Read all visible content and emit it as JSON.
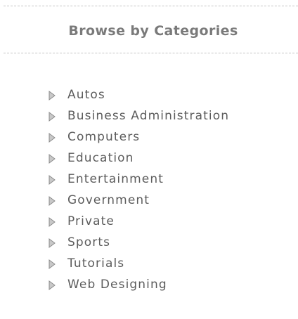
{
  "panel": {
    "title": "Browse by Categories"
  },
  "categories": [
    {
      "label": "Autos",
      "icon": "arrow-right-icon"
    },
    {
      "label": "Business Administration",
      "icon": "arrow-right-icon"
    },
    {
      "label": "Computers",
      "icon": "arrow-right-icon"
    },
    {
      "label": "Education",
      "icon": "arrow-right-icon"
    },
    {
      "label": "Entertainment",
      "icon": "arrow-right-icon"
    },
    {
      "label": "Government",
      "icon": "arrow-right-icon"
    },
    {
      "label": "Private",
      "icon": "arrow-right-icon"
    },
    {
      "label": "Sports",
      "icon": "arrow-right-icon"
    },
    {
      "label": "Tutorials",
      "icon": "arrow-right-icon"
    },
    {
      "label": "Web Designing",
      "icon": "arrow-right-icon"
    }
  ],
  "colors": {
    "heading": "#7a7a7a",
    "text": "#5c5c5c",
    "bullet_fill": "#c8c8c8",
    "bullet_stroke": "#8c8c8c",
    "rule": "#c4c4c4"
  }
}
